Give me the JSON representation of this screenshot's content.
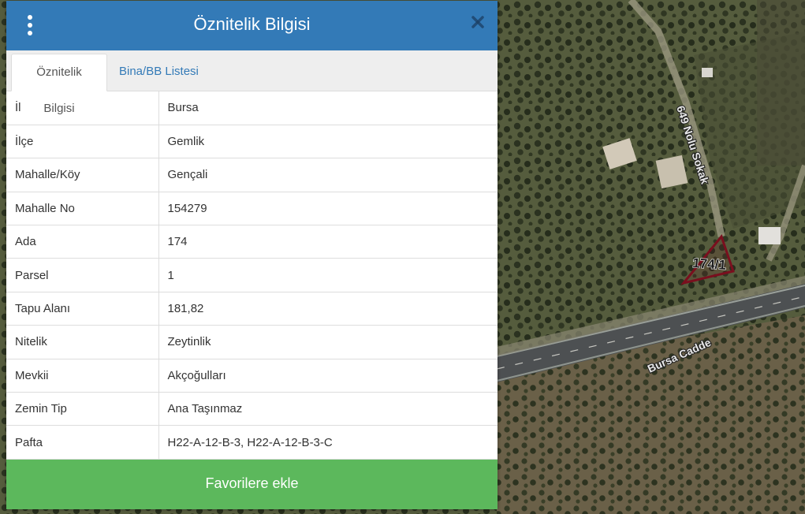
{
  "map": {
    "road_label": "Bursa Cadde",
    "street_label": "649 Nolu Sokak",
    "parcel_label": "174/1",
    "parcel_outline_color": "#7a0f1e"
  },
  "panel": {
    "title": "Öznitelik Bilgisi",
    "header_color": "#337ab7",
    "menu_icon": "vertical-dots-icon",
    "close_icon": "close-icon",
    "tabs": [
      {
        "label": "Öznitelik Bilgisi",
        "active": true
      },
      {
        "label": "Bina/BB Listesi",
        "active": false
      }
    ],
    "rows": [
      {
        "key": "İl",
        "value": "Bursa"
      },
      {
        "key": "İlçe",
        "value": "Gemlik"
      },
      {
        "key": "Mahalle/Köy",
        "value": "Gençali"
      },
      {
        "key": "Mahalle No",
        "value": "154279"
      },
      {
        "key": "Ada",
        "value": "174"
      },
      {
        "key": "Parsel",
        "value": "1"
      },
      {
        "key": "Tapu Alanı",
        "value": "181,82"
      },
      {
        "key": "Nitelik",
        "value": "Zeytinlik"
      },
      {
        "key": "Mevkii",
        "value": "Akçoğulları"
      },
      {
        "key": "Zemin Tip",
        "value": "Ana Taşınmaz"
      },
      {
        "key": "Pafta",
        "value": "H22-A-12-B-3, H22-A-12-B-3-C"
      }
    ],
    "favorite_button": "Favorilere ekle",
    "favorite_color": "#5cb85c"
  }
}
